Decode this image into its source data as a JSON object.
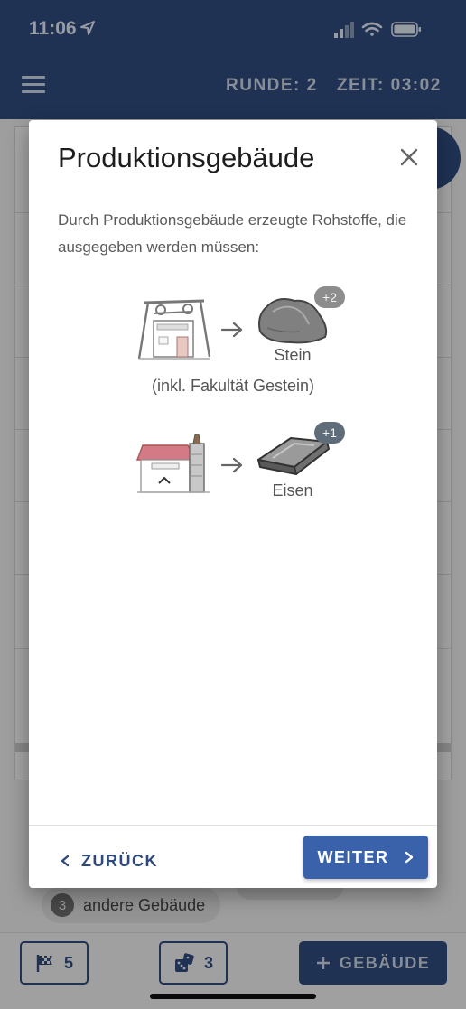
{
  "status_bar": {
    "time": "11:06",
    "location_icon": "location-arrow-icon",
    "signal_icon": "cellular-signal-icon",
    "wifi_icon": "wifi-icon",
    "battery_icon": "battery-icon"
  },
  "header": {
    "menu_icon": "hamburger-menu-icon",
    "round": "RUNDE: 2",
    "time": "ZEIT: 03:02"
  },
  "background": {
    "chip_count": "3",
    "chip_label": "andere Gebäude",
    "bottom_bar": {
      "flag_count": "5",
      "dice_count": "3",
      "build_label": "GEBÄUDE",
      "build_icon": "plus-icon"
    }
  },
  "modal": {
    "title": "Produktionsgebäude",
    "close_icon": "close-icon",
    "description": "Durch Produktionsgebäude erzeugte Rohstoffe, die ausgegeben werden müssen:",
    "productions": [
      {
        "building": "mine-building-image",
        "resource": "Stein",
        "amount": "+2",
        "resource_image": "stone-image"
      },
      {
        "building": "smelter-building-image",
        "resource": "Eisen",
        "amount": "+1",
        "resource_image": "iron-ingot-image"
      }
    ],
    "note": "(inkl. Fakultät Gestein)",
    "back_label": "ZURÜCK",
    "next_label": "WEITER"
  },
  "colors": {
    "primary": "#2e4a7c",
    "button": "#3a62ab",
    "badge_stone": "#8d8d8d",
    "badge_iron": "#5f6d7a"
  }
}
